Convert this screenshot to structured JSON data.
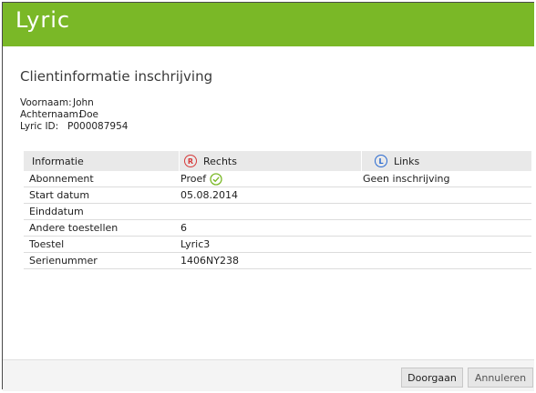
{
  "header": {
    "logo_text": "Lyric",
    "bg_color": "#7ab827"
  },
  "page": {
    "title": "Clientinformatie inschrijving"
  },
  "client": {
    "first_name_label": "Voornaam:",
    "first_name": "John",
    "last_name_label": "Achternaam:",
    "last_name": "Doe",
    "id_label": "Lyric ID:",
    "id": "P000087954"
  },
  "table": {
    "headers": {
      "info": "Informatie",
      "right_icon": "R",
      "right": "Rechts",
      "left_icon": "L",
      "left": "Links"
    },
    "rows": [
      {
        "label": "Abonnement",
        "right": "Proef",
        "right_icon": "check-circle-icon",
        "left": "Geen inschrijving"
      },
      {
        "label": "Start datum",
        "right": "05.08.2014",
        "left": ""
      },
      {
        "label": "Einddatum",
        "right": "",
        "left": ""
      },
      {
        "label": "Andere toestellen",
        "right": "6",
        "left": ""
      },
      {
        "label": "Toestel",
        "right": "Lyric3",
        "left": ""
      },
      {
        "label": "Serienummer",
        "right": "1406NY238",
        "left": ""
      }
    ]
  },
  "footer": {
    "continue_label": "Doorgaan",
    "cancel_label": "Annuleren"
  },
  "colors": {
    "right_ear": "#d63a3a",
    "left_ear": "#2a6ad0",
    "check": "#7ab827"
  }
}
